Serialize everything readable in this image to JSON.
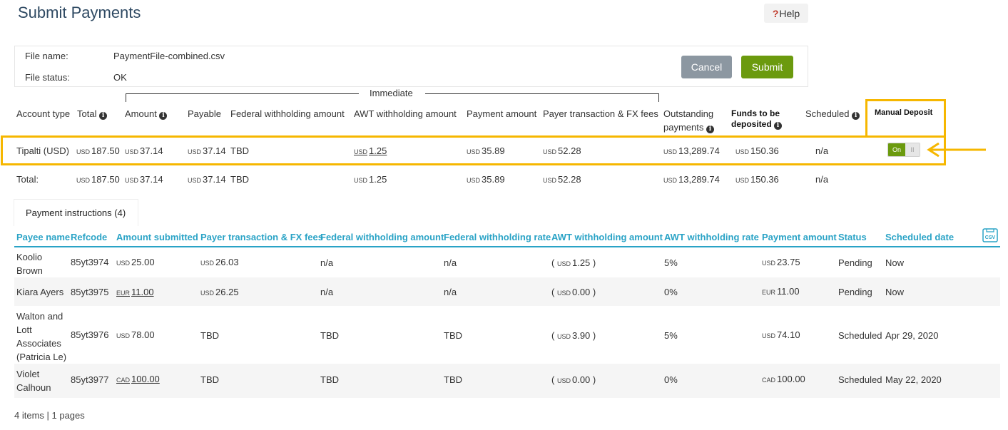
{
  "page": {
    "title": "Submit Payments",
    "help_label": "Help",
    "help_prefix": "?"
  },
  "file": {
    "name_label": "File name:",
    "name_value": "PaymentFile-combined.csv",
    "status_label": "File status:",
    "status_value": "OK",
    "cancel_label": "Cancel",
    "submit_label": "Submit"
  },
  "summary": {
    "group_label": "Immediate",
    "headers": {
      "account_type": "Account type",
      "total": "Total",
      "amount": "Amount",
      "payable": "Payable",
      "federal_withholding": "Federal withholding amount",
      "awt_withholding": "AWT withholding amount",
      "payment_amount": "Payment amount",
      "payer_fees": "Payer transaction & FX fees",
      "outstanding_1": "Outstanding",
      "outstanding_2": "payments",
      "funds_1": "Funds to be",
      "funds_2": "deposited",
      "scheduled": "Scheduled",
      "manual_deposit": "Manual Deposit"
    },
    "account_row": {
      "account_type": "Tipalti (USD)",
      "total_cur": "USD",
      "total": "187.50",
      "amount_cur": "USD",
      "amount": "37.14",
      "payable_cur": "USD",
      "payable": "37.14",
      "federal": "TBD",
      "awt_cur": "USD",
      "awt": "1.25",
      "payment_cur": "USD",
      "payment": "35.89",
      "fees_cur": "USD",
      "fees": "52.28",
      "outstanding_cur": "USD",
      "outstanding": "13,289.74",
      "funds_cur": "USD",
      "funds": "150.36",
      "scheduled": "n/a",
      "toggle_on": "On",
      "toggle_off": "II"
    },
    "total_row": {
      "label": "Total:",
      "total_cur": "USD",
      "total": "187.50",
      "amount_cur": "USD",
      "amount": "37.14",
      "payable_cur": "USD",
      "payable": "37.14",
      "federal": "TBD",
      "awt_cur": "USD",
      "awt": "1.25",
      "payment_cur": "USD",
      "payment": "35.89",
      "fees_cur": "USD",
      "fees": "52.28",
      "outstanding_cur": "USD",
      "outstanding": "13,289.74",
      "funds_cur": "USD",
      "funds": "150.36",
      "scheduled": "n/a"
    }
  },
  "instructions": {
    "tab_label": "Payment instructions (4)",
    "headers": {
      "payee": "Payee name",
      "refcode": "Refcode",
      "amount_submitted": "Amount submitted",
      "payer_fees": "Payer transaction & FX fees",
      "federal_amount": "Federal withholding amount",
      "federal_rate": "Federal withholding rate",
      "awt_amount": "AWT withholding amount",
      "awt_rate": "AWT withholding rate",
      "payment_amount": "Payment amount",
      "status": "Status",
      "scheduled_date": "Scheduled date"
    },
    "csv_icon_label": "CSV",
    "rows": [
      {
        "payee": [
          "Koolio",
          "Brown"
        ],
        "refcode": "85yt3974",
        "amount_cur": "USD",
        "amount": "25.00",
        "fees_cur": "USD",
        "fees": "26.03",
        "federal_amount": "n/a",
        "federal_rate": "n/a",
        "awt_prefix": "(",
        "awt_cur": "USD",
        "awt": "1.25",
        "awt_suffix": ")",
        "awt_rate": "5%",
        "payment_cur": "USD",
        "payment": "23.75",
        "status": "Pending",
        "date": "Now"
      },
      {
        "payee": [
          "Kiara Ayers"
        ],
        "refcode": "85yt3975",
        "amount_cur": "EUR",
        "amount": "11.00",
        "fees_cur": "USD",
        "fees": "26.25",
        "federal_amount": "n/a",
        "federal_rate": "n/a",
        "awt_prefix": "(",
        "awt_cur": "USD",
        "awt": "0.00",
        "awt_suffix": ")",
        "awt_rate": "0%",
        "payment_cur": "EUR",
        "payment": "11.00",
        "status": "Pending",
        "date": "Now"
      },
      {
        "payee": [
          "Walton and",
          "Lott",
          "Associates",
          "(Patricia Le)"
        ],
        "refcode": "85yt3976",
        "amount_cur": "USD",
        "amount": "78.00",
        "fees": "TBD",
        "federal_amount": "TBD",
        "federal_rate": "TBD",
        "awt_prefix": "(",
        "awt_cur": "USD",
        "awt": "3.90",
        "awt_suffix": ")",
        "awt_rate": "5%",
        "payment_cur": "USD",
        "payment": "74.10",
        "status": "Scheduled",
        "date": "Apr 29, 2020"
      },
      {
        "payee": [
          "Violet",
          "Calhoun"
        ],
        "refcode": "85yt3977",
        "amount_cur": "CAD",
        "amount": "100.00",
        "fees": "TBD",
        "federal_amount": "TBD",
        "federal_rate": "TBD",
        "awt_prefix": "(",
        "awt_cur": "USD",
        "awt": "0.00",
        "awt_suffix": ")",
        "awt_rate": "0%",
        "payment_cur": "CAD",
        "payment": "100.00",
        "status": "Scheduled",
        "date": "May 22, 2020"
      }
    ],
    "footer": "4 items | 1 pages"
  },
  "colors": {
    "accent": "#2aa3c6",
    "highlight": "#f6b700",
    "submit": "#6b9a0e",
    "cancel": "#8c97a1"
  }
}
